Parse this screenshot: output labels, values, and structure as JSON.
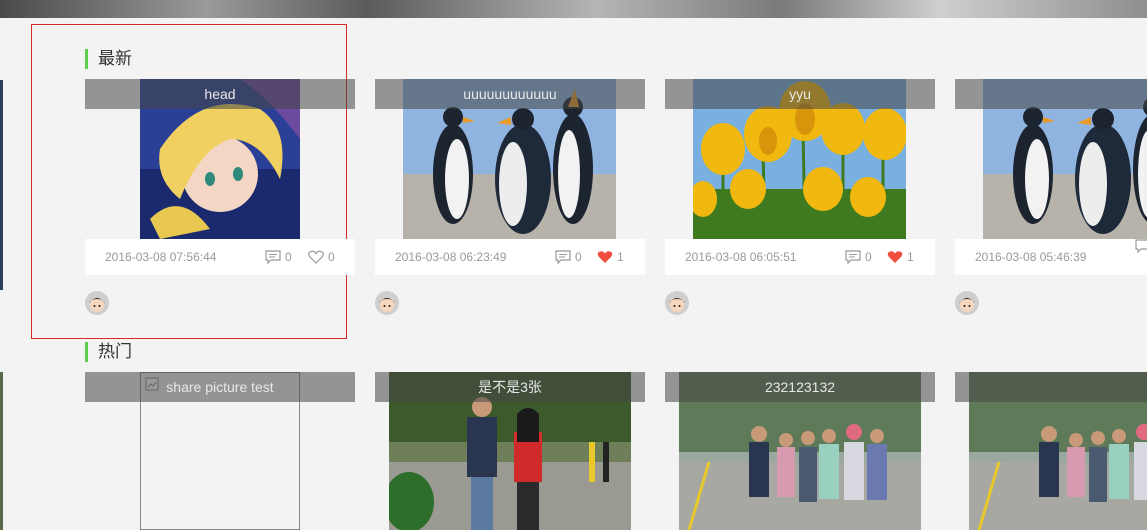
{
  "sections": {
    "latest": {
      "title": "最新"
    },
    "hot": {
      "title": "热门"
    }
  },
  "latest_cards": [
    {
      "title": "head",
      "date": "2016-03-08 07:56:44",
      "comments": "0",
      "likes": "0",
      "liked": false,
      "image": "anime-girl"
    },
    {
      "title": "uuuuuuuuuuuu",
      "date": "2016-03-08 06:23:49",
      "comments": "0",
      "likes": "1",
      "liked": true,
      "image": "penguins"
    },
    {
      "title": "yyu",
      "date": "2016-03-08 06:05:51",
      "comments": "0",
      "likes": "1",
      "liked": true,
      "image": "tulips"
    },
    {
      "title": "",
      "date": "2016-03-08 05:46:39",
      "comments": "",
      "likes": "",
      "liked": false,
      "image": "penguins"
    }
  ],
  "hot_cards": [
    {
      "title": "share picture test",
      "image": "broken-image"
    },
    {
      "title": "是不是3张",
      "image": "couple-photo"
    },
    {
      "title": "232123132",
      "image": "group-photo"
    },
    {
      "title": "",
      "image": "group-photo"
    }
  ],
  "colors": {
    "accent": "#5bd14b",
    "like": "#f04e3e",
    "selection": "#d42a2a"
  }
}
